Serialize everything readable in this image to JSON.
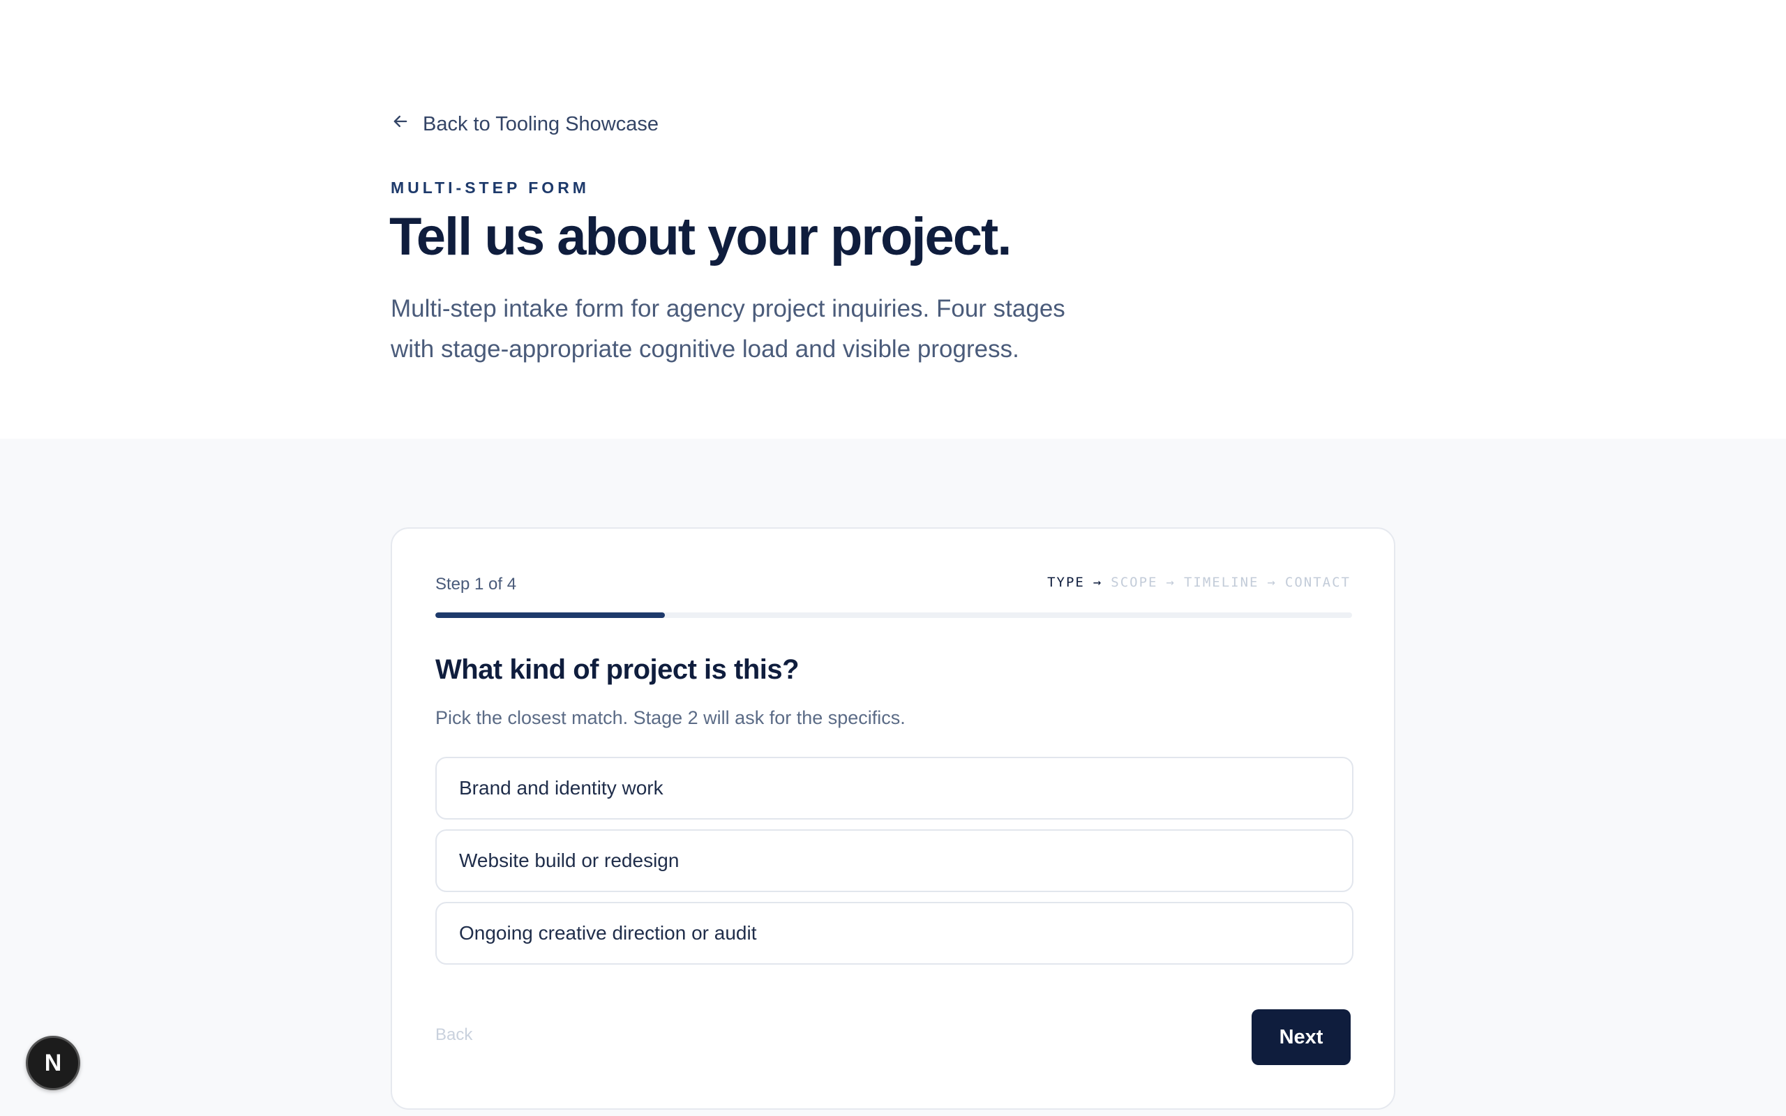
{
  "header": {
    "back_link": "Back to Tooling Showcase",
    "eyebrow": "MULTI-STEP FORM",
    "title": "Tell us about your project.",
    "intro_line1": "Multi-step intake form for agency project inquiries. Four stages",
    "intro_line2": "with stage-appropriate cognitive load and visible progress."
  },
  "form": {
    "step_label": "Step 1 of 4",
    "progress": 0.25,
    "stages": [
      {
        "label": "TYPE",
        "active": true
      },
      {
        "label": "SCOPE",
        "active": false
      },
      {
        "label": "TIMELINE",
        "active": false
      },
      {
        "label": "CONTACT",
        "active": false
      }
    ],
    "arrow_glyph": "→",
    "question": "What kind of project is this?",
    "hint": "Pick the closest match. Stage 2 will ask for the specifics.",
    "options": [
      "Brand and identity work",
      "Website build or redesign",
      "Ongoing creative direction or audit"
    ],
    "back_label": "Back",
    "next_label": "Next"
  },
  "dev_badge": {
    "letter": "N"
  },
  "colors": {
    "navy": "#0f1d3d",
    "accent": "#1e3a6b",
    "muted": "#c3ccd9",
    "panel_bg": "#f8f9fb"
  }
}
